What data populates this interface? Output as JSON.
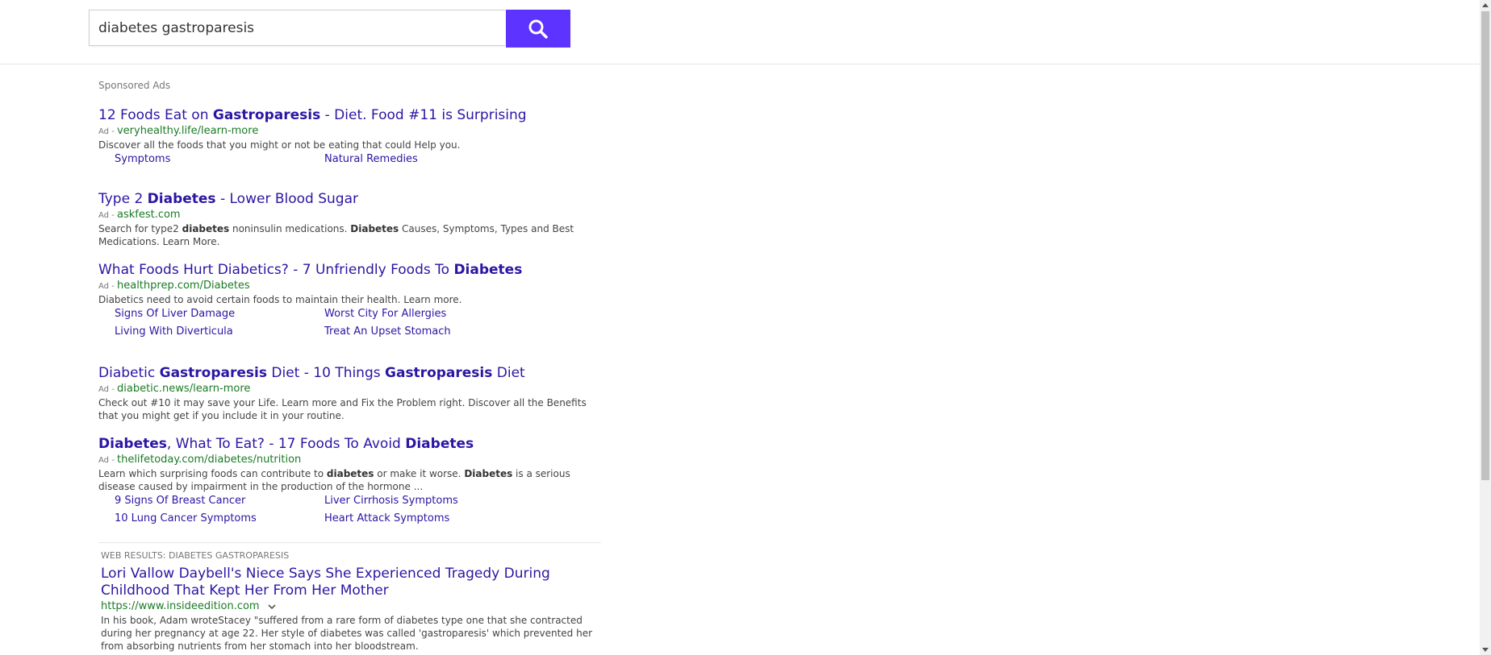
{
  "search": {
    "query": "diabetes gastroparesis"
  },
  "icons": {
    "search": "search-icon",
    "dropdown": "chevron-down-icon"
  },
  "colors": {
    "accent": "#5c33ff",
    "link": "#2a16a3",
    "url": "#1a7b26"
  },
  "sponsored": {
    "label": "Sponsored Ads",
    "ad_tag": "Ad -",
    "ads": [
      {
        "title_parts": [
          [
            "12 Foods Eat on ",
            false
          ],
          [
            "Gastroparesis",
            true
          ],
          [
            " - Diet. Food #11 is Surprising",
            false
          ]
        ],
        "url": "veryhealthy.life/learn-more",
        "desc_parts": [
          [
            "Discover all the foods that you might or not be eating that could Help you.",
            false
          ]
        ],
        "sitelinks": [
          "Symptoms",
          "Natural Remedies"
        ]
      },
      {
        "title_parts": [
          [
            "Type 2 ",
            false
          ],
          [
            "Diabetes",
            true
          ],
          [
            " - Lower Blood Sugar",
            false
          ]
        ],
        "url": "askfest.com",
        "desc_parts": [
          [
            "Search for type2 ",
            false
          ],
          [
            "diabetes",
            true
          ],
          [
            " noninsulin medications. ",
            false
          ],
          [
            "Diabetes",
            true
          ],
          [
            " Causes, Symptoms, Types and Best Medications. Learn More.",
            false
          ]
        ],
        "sitelinks": []
      },
      {
        "title_parts": [
          [
            "What Foods Hurt Diabetics? - 7 Unfriendly Foods To ",
            false
          ],
          [
            "Diabetes",
            true
          ]
        ],
        "url": "healthprep.com/Diabetes",
        "desc_parts": [
          [
            "Diabetics need to avoid certain foods to maintain their health. Learn more.",
            false
          ]
        ],
        "sitelinks": [
          "Signs Of Liver Damage",
          "Worst City For Allergies",
          "Living With Diverticula",
          "Treat An Upset Stomach"
        ]
      },
      {
        "title_parts": [
          [
            "Diabetic ",
            false
          ],
          [
            "Gastroparesis",
            true
          ],
          [
            " Diet - 10 Things ",
            false
          ],
          [
            "Gastroparesis",
            true
          ],
          [
            " Diet",
            false
          ]
        ],
        "url": "diabetic.news/learn-more",
        "desc_parts": [
          [
            "Check out #10 it may save your Life. Learn more and Fix the Problem right. Discover all the Benefits that you might get if you include it in your routine.",
            false
          ]
        ],
        "sitelinks": []
      },
      {
        "title_parts": [
          [
            "Diabetes",
            true
          ],
          [
            ", What To Eat? - 17 Foods To Avoid ",
            false
          ],
          [
            "Diabetes",
            true
          ]
        ],
        "url": "thelifetoday.com/diabetes/nutrition",
        "desc_parts": [
          [
            "Learn which surprising foods can contribute to ",
            false
          ],
          [
            "diabetes",
            true
          ],
          [
            " or make it worse. ",
            false
          ],
          [
            "Diabetes",
            true
          ],
          [
            " is a serious disease caused by impairment in the production of the hormone ...",
            false
          ]
        ],
        "sitelinks": [
          "9 Signs Of Breast Cancer",
          "Liver Cirrhosis Symptoms",
          "10 Lung Cancer Symptoms",
          "Heart Attack Symptoms"
        ]
      }
    ]
  },
  "web": {
    "label": "WEB RESULTS: DIABETES GASTROPARESIS",
    "results": [
      {
        "title": "Lori Vallow Daybell's Niece Says She Experienced Tragedy During Childhood That Kept Her From Her Mother",
        "url": "https://www.insideedition.com",
        "desc": "In his book, Adam wroteStacey \"suffered from a rare form of diabetes type one that she contracted during her pregnancy at age 22. Her style of diabetes was called 'gastroparesis' which prevented her from absorbing nutrients from her stomach into her bloodstream."
      }
    ]
  }
}
